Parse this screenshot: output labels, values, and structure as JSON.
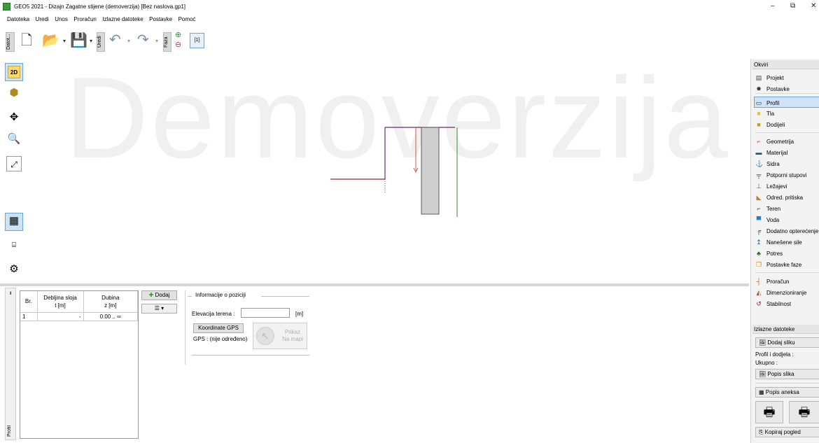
{
  "window": {
    "title": "GEO5 2021 - Dizajn Zagatne stijene (demoverzija) [Bez naslova.gp1]",
    "minimize": "–",
    "maximize": "⧉",
    "close": "✕"
  },
  "menu": {
    "items": [
      "Datoteka",
      "Uredi",
      "Unos",
      "Proračun",
      "Izlazne datoteke",
      "Postavke",
      "Pomoć"
    ]
  },
  "toolbar": {
    "file_label": "Datot...",
    "edit_label": "Uredi",
    "phase_label": "Faza",
    "phase_tab": "[1]"
  },
  "canvas": {
    "watermark": "Demoverzija"
  },
  "table": {
    "headers": [
      {
        "line1": "Br.",
        "line2": ""
      },
      {
        "line1": "Debljina sloja",
        "line2": "t [m]"
      },
      {
        "line1": "Dubina",
        "line2": "z [m]"
      }
    ],
    "rows": [
      {
        "no": "1",
        "thickness": "-",
        "depth": "0.00 .. ∞"
      }
    ]
  },
  "add_button": {
    "label": "Dodaj"
  },
  "position_info": {
    "legend": "Informacije o poziciji",
    "elevation_label": "Elevacija terena :",
    "elevation_value": "",
    "elevation_unit": "[m]",
    "gps_button": "Koordinate GPS",
    "gps_status": "GPS : (nije određeno)",
    "map_button_line1": "Prikaz",
    "map_button_line2": "Na mapi"
  },
  "bottom_tab": {
    "label": "Profil"
  },
  "frames": {
    "header": "Okviri",
    "items": [
      {
        "label": "Projekt",
        "icon": "document-icon",
        "glyph": "▤",
        "color": "#444444"
      },
      {
        "label": "Postavke",
        "icon": "settings-icon",
        "glyph": "✹",
        "color": "#333333"
      },
      {
        "label": "Profil",
        "icon": "profile-icon",
        "glyph": "▭",
        "color": "#333333",
        "selected": true
      },
      {
        "label": "Tla",
        "icon": "soil-icon",
        "glyph": "■",
        "color": "#e8c040"
      },
      {
        "label": "Dodijeli",
        "icon": "assign-icon",
        "glyph": "■",
        "color": "#c0a020"
      },
      {
        "label": "Geometrija",
        "icon": "geometry-icon",
        "glyph": "⌐",
        "color": "#c03030"
      },
      {
        "label": "Materijal",
        "icon": "material-icon",
        "glyph": "▬",
        "color": "#305080"
      },
      {
        "label": "Sidra",
        "icon": "anchor-icon",
        "glyph": "⚓",
        "color": "#7030a0"
      },
      {
        "label": "Potporni stupovi",
        "icon": "props-icon",
        "glyph": "╤",
        "color": "#7030a0"
      },
      {
        "label": "Ležajevi",
        "icon": "supports-icon",
        "glyph": "⊥",
        "color": "#555555"
      },
      {
        "label": "Odred. pritiska",
        "icon": "pressure-icon",
        "glyph": "◣",
        "color": "#c08020"
      },
      {
        "label": "Teren",
        "icon": "terrain-icon",
        "glyph": "⌐",
        "color": "#333333"
      },
      {
        "label": "Voda",
        "icon": "water-icon",
        "glyph": "▀",
        "color": "#2080d0"
      },
      {
        "label": "Dodatno opterećenje",
        "icon": "surcharge-icon",
        "glyph": "╒",
        "color": "#333333"
      },
      {
        "label": "Nanešene sile",
        "icon": "forces-icon",
        "glyph": "↥",
        "color": "#2040a0"
      },
      {
        "label": "Potres",
        "icon": "earthquake-icon",
        "glyph": "♣",
        "color": "#306030"
      },
      {
        "label": "Postavke faze",
        "icon": "phase-settings-icon",
        "glyph": "❐",
        "color": "#c09020"
      },
      {
        "label": "Proračun",
        "icon": "analysis-icon",
        "glyph": "┤",
        "color": "#d05020"
      },
      {
        "label": "Dimenzioniranje",
        "icon": "dimensioning-icon",
        "glyph": "◭",
        "color": "#c04020"
      },
      {
        "label": "Stabilnost",
        "icon": "stability-icon",
        "glyph": "↺",
        "color": "#a02020"
      }
    ]
  },
  "outputs": {
    "header": "Izlazne datoteke",
    "add_picture": "Dodaj sliku",
    "profile_assign": "Profil i dodjela :",
    "total": "Ukupno :",
    "list_pictures": "Popis slika",
    "list_annexes": "Popis aneksa",
    "copy_view": "Kopiraj pogled"
  }
}
